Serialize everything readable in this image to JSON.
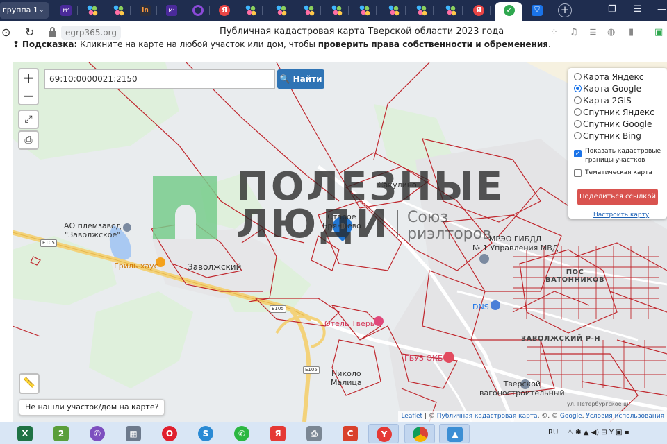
{
  "browser": {
    "group_label": "группа 1",
    "tab_icons": [
      "m2-icon",
      "colorful-dots-icon",
      "colorful-dots-icon",
      "in-icon",
      "m2-icon",
      "ring-icon",
      "yandex-icon",
      "colorful-dots-icon",
      "colorful-dots-icon",
      "colorful-dots-icon",
      "colorful-dots-icon",
      "colorful-dots-icon",
      "colorful-dots-icon",
      "colorful-dots-icon",
      "yandex-icon",
      "checkmark-icon",
      "shield-icon"
    ],
    "domain": "egrp365.org",
    "page_title": "Публичная кадастровая карта Тверской области 2023 года"
  },
  "hint": {
    "prefix": "Подсказка:",
    "text": "Кликните на карте на любой участок или дом, чтобы",
    "emphasis": "проверить права собственности и обременения",
    "suffix": "."
  },
  "map": {
    "search_value": "69:10:0000021:2150",
    "search_button": "Найти",
    "zoom_in": "+",
    "zoom_out": "−",
    "layers": [
      {
        "label": "Карта Яндекс",
        "selected": false
      },
      {
        "label": "Карта Google",
        "selected": true
      },
      {
        "label": "Карта 2GIS",
        "selected": false
      },
      {
        "label": "Спутник Яндекс",
        "selected": false
      },
      {
        "label": "Спутник Google",
        "selected": false
      },
      {
        "label": "Спутник Bing",
        "selected": false
      }
    ],
    "show_cadastral_label": "Показать кадастровые границы участков",
    "show_cadastral_checked": true,
    "thematic_label": "Тематическая карта",
    "thematic_checked": false,
    "share_button": "Поделиться ссылкой",
    "configure_link": "Настроить карту",
    "not_found_button": "Не нашли участок/дом на карте?",
    "attribution": {
      "leaflet": "Leaflet",
      "sep": " | © ",
      "cadastral": "Публичная кадастровая карта",
      "mid": ", ©, © ",
      "google": "Google",
      "comma": ", ",
      "terms": "Условия использования"
    },
    "labels": {
      "sakulino": "Сакулино",
      "staroe_1": "Старое",
      "staroe_2": "Брянцево",
      "ao_1": "АО племзавод",
      "ao_2": "\"Заволжское\"",
      "grill": "Гриль хаус",
      "zavolzhsky": "Заволжский",
      "mreo_1": "МРЭО ГИБДД",
      "mreo_2": "№ 1 Управления МВД",
      "pos_1": "ПОС",
      "pos_2": "ВАТОННИКОВ",
      "dns": "DNS",
      "hotel": "Отель Тверь",
      "district": "ЗАВОЛЖСКИЙ Р-Н",
      "gbuz": "ГБУЗ ОКБ",
      "nikolo_1": "Николо",
      "nikolo_2": "Малица",
      "tver_1": "Тверской",
      "tver_2": "вагоностроительный",
      "street": "ул. Петербургское ш."
    },
    "road_labels": [
      "E105",
      "E105",
      "E105"
    ]
  },
  "watermark": {
    "line1": "ПОЛЕЗНЫЕ",
    "line2": "ЛЮДИ",
    "sub1": "Союз",
    "sub2": "риэлторов"
  },
  "taskbar": {
    "apps": [
      "excel-icon",
      "updates-icon",
      "viber-icon",
      "calculator-icon",
      "opera-icon",
      "skype-icon",
      "whatsapp-icon",
      "yandex-icon",
      "printer-icon",
      "ccleaner-icon",
      "yandex-browser-icon",
      "chrome-icon",
      "photos-icon"
    ],
    "language": "RU"
  },
  "colors": {
    "tabbar": "#1f2d4f",
    "map_bg": "#e9ecee",
    "cadastral": "#c0272d",
    "search_button": "#2f74b5",
    "share_button": "#d9534f"
  }
}
